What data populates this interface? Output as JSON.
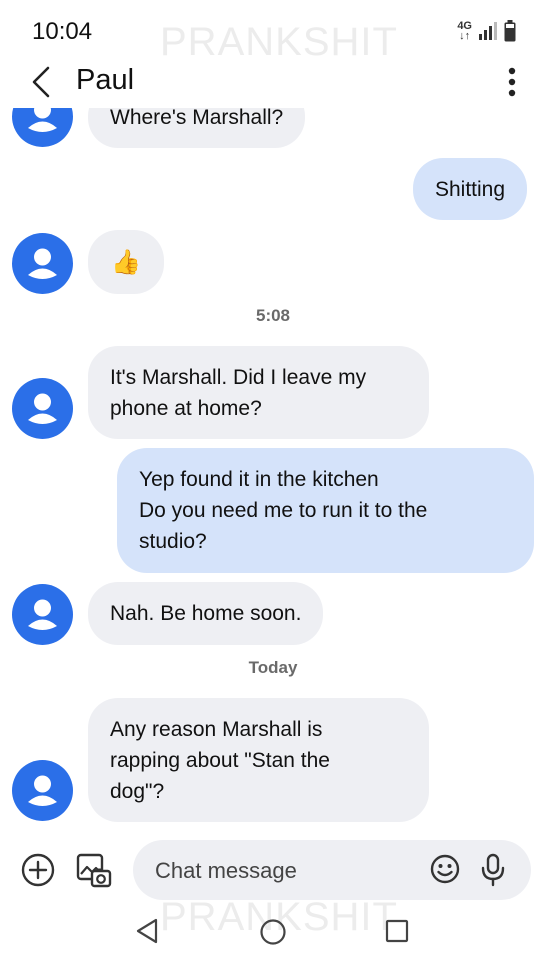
{
  "status_bar": {
    "time": "10:04",
    "network": "4G",
    "watermark": "PRANKSHIT"
  },
  "header": {
    "contact_name": "Paul"
  },
  "messages": [
    {
      "type": "incoming",
      "text": "Where's Marshall?"
    },
    {
      "type": "outgoing",
      "text": "Shitting"
    },
    {
      "type": "incoming",
      "text": "👍"
    },
    {
      "type": "timestamp",
      "text": "5:08"
    },
    {
      "type": "incoming",
      "text": "It's Marshall. Did I leave my\nphone at home?"
    },
    {
      "type": "outgoing",
      "text": "Yep found it in the kitchen\nDo you need me to run it to the\nstudio?"
    },
    {
      "type": "incoming",
      "text": "Nah. Be home soon."
    },
    {
      "type": "timestamp",
      "text": "Today"
    },
    {
      "type": "incoming",
      "text": "Any reason Marshall is\nrapping about \"Stan the\ndog\"?"
    }
  ],
  "composer": {
    "placeholder": "Chat message"
  },
  "colors": {
    "avatar": "#2b6fe8",
    "incoming_bubble": "#eeeff3",
    "outgoing_bubble": "#d5e3fa"
  },
  "icons": [
    "back-arrow-icon",
    "more-vert-icon",
    "add-circle-icon",
    "gallery-icon",
    "emoji-icon",
    "mic-icon",
    "nav-back-icon",
    "nav-home-icon",
    "nav-recents-icon"
  ]
}
